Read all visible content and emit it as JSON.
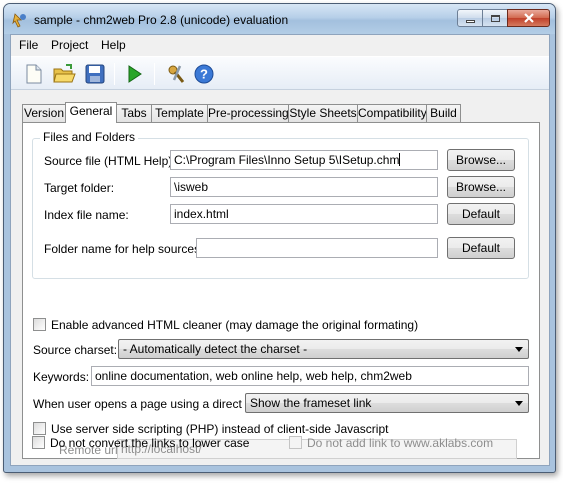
{
  "window": {
    "title": "sample - chm2web Pro 2.8 (unicode) evaluation"
  },
  "menu": [
    "File",
    "Project",
    "Help"
  ],
  "toolbar": {
    "icons": [
      "new-document-icon",
      "open-folder-icon",
      "save-icon",
      "run-icon",
      "tools-icon",
      "help-icon"
    ]
  },
  "tabs": [
    "Version",
    "General",
    "Tabs",
    "Template",
    "Pre-processing",
    "Style Sheets",
    "Compatibility",
    "Build"
  ],
  "active_tab": "General",
  "files_group": {
    "title": "Files and Folders",
    "source_label": "Source file (HTML Help):",
    "source_value": "C:\\Program Files\\Inno Setup 5\\ISetup.chm",
    "target_label": "Target folder:",
    "target_value": "\\isweb",
    "index_label": "Index file name:",
    "index_value": "index.html",
    "help_sources_label": "Folder name for help sources:",
    "help_sources_value": "",
    "browse_label": "Browse...",
    "default_label": "Default"
  },
  "options": {
    "html_cleaner_label": "Enable advanced HTML cleaner (may damage the original formating)",
    "charset_label": "Source charset:",
    "charset_value": "- Automatically detect the charset -",
    "keywords_label": "Keywords:",
    "keywords_value": "online documentation, web online help, web help, chm2web",
    "direct_link_label": "When user opens a page using a direct link:",
    "direct_link_value": "Show the frameset link",
    "php_label": "Use server side scripting (PHP) instead of client-side Javascript",
    "remote_url_label": "Remote url:",
    "remote_url_value": "http://localhost/",
    "lowercase_label": "Do not convert the links to lower case",
    "aklabs_label": "Do not add link to www.aklabs.com"
  },
  "colors": {
    "title_bar": "#b6cfe8",
    "close_button": "#c0402a",
    "dialog_bg": "#f0f0f0",
    "panel_bg": "#ffffff"
  }
}
